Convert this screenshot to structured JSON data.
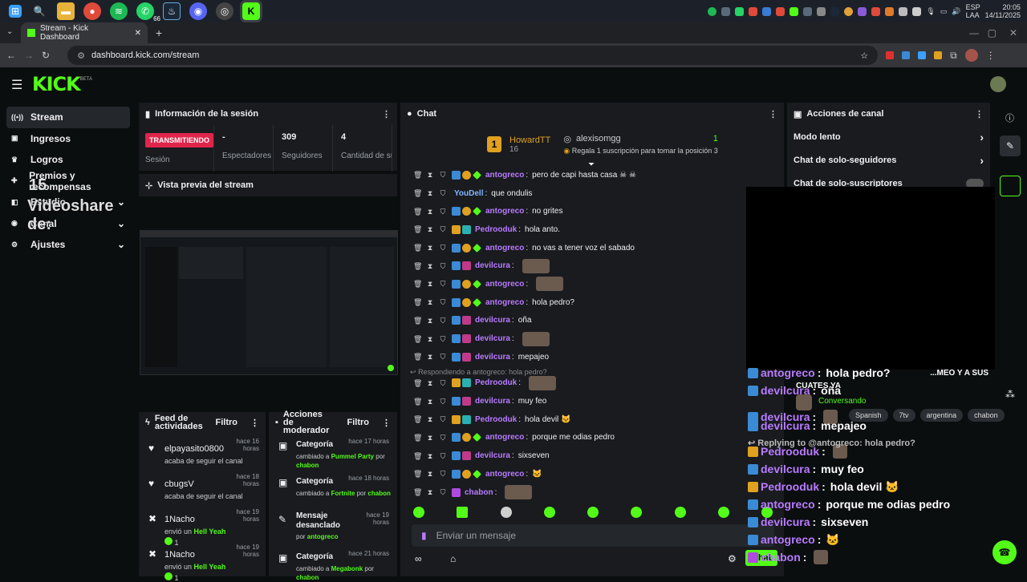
{
  "taskbar": {
    "time": "20:05",
    "date": "14/11/2025",
    "lang": "ESP",
    "lang2": "LAA",
    "badge_count": "66"
  },
  "browser": {
    "tab_title": "Stream - Kick Dashboard",
    "url": "dashboard.kick.com/stream"
  },
  "app": {
    "logo": "KICK",
    "logo_sup": "BETA"
  },
  "sidebar": {
    "items": [
      {
        "label": "Stream",
        "icon": "broadcast-icon"
      },
      {
        "label": "Ingresos",
        "icon": "money-icon"
      },
      {
        "label": "Logros",
        "icon": "trophy-icon"
      },
      {
        "label": "Premios y recompensas",
        "icon": "gift-icon"
      },
      {
        "label": "Estudio",
        "icon": "studio-icon"
      },
      {
        "label": "Canal",
        "icon": "user-icon"
      },
      {
        "label": "Ajustes",
        "icon": "gear-icon"
      }
    ],
    "overlay_text": "Videoshare de:",
    "overlay_num": "15"
  },
  "session": {
    "title": "Información de la sesión",
    "status": "TRANSMITIENDO",
    "status_label": "Sesión",
    "stats": [
      {
        "value": "-",
        "label": "Espectadores"
      },
      {
        "value": "309",
        "label": "Seguidores"
      },
      {
        "value": "4",
        "label": "Cantidad de suscripciones"
      }
    ]
  },
  "preview": {
    "title": "Vista previa del stream"
  },
  "feed": {
    "title": "Feed de actividades",
    "filter": "Filtro",
    "items": [
      {
        "user": "elpayasito0800",
        "time": "hace 16 horas",
        "desc": "acaba de seguir el canal"
      },
      {
        "user": "cbugsV",
        "time": "hace 18 horas",
        "desc": "acaba de seguir el canal"
      },
      {
        "user": "1Nacho",
        "time": "hace 19 horas",
        "desc": "envió un",
        "item": "Hell Yeah",
        "count": "1"
      },
      {
        "user": "1Nacho",
        "time": "hace 19 horas",
        "desc": "envió un",
        "item": "Hell Yeah",
        "count": "1"
      }
    ]
  },
  "modactions": {
    "title": "Acciones de moderador",
    "filter": "Filtro",
    "items": [
      {
        "title": "Categoría",
        "time": "hace 17 horas",
        "desc": "cambiado a",
        "value": "Pummel Party",
        "by_word": "por",
        "by": "chabon"
      },
      {
        "title": "Categoría",
        "time": "hace 18 horas",
        "desc": "cambiado a",
        "value": "Fortnite",
        "by_word": "por",
        "by": "chabon"
      },
      {
        "title": "Mensaje desanclado",
        "time": "hace 19 horas",
        "by_word": "por",
        "by": "antogreco"
      },
      {
        "title": "Categoría",
        "time": "hace 21 horas",
        "desc": "cambiado a",
        "value": "Megabonk",
        "by_word": "por",
        "by": "chabon"
      }
    ]
  },
  "chat": {
    "title": "Chat",
    "leader": {
      "rank": "1",
      "name": "HowardTT",
      "count": "16",
      "gifter": "alexisomgg",
      "gift_count": "1",
      "gift_text": "Regala 1 suscripción para tomar la posición 3"
    },
    "reply_note": "Respondiendo a antogreco: hola pedro?",
    "messages": [
      {
        "user": "antogreco",
        "color": "#b97bff",
        "text": "pero de capi hasta casa ☠ ☠"
      },
      {
        "user": "YouDell",
        "color": "#7fb7ff",
        "text": "que ondulis"
      },
      {
        "user": "antogreco",
        "color": "#b97bff",
        "text": "no grites"
      },
      {
        "user": "Pedrooduk",
        "color": "#b97bff",
        "text": "hola anto."
      },
      {
        "user": "antogreco",
        "color": "#b97bff",
        "text": "no vas a tener voz el sabado"
      },
      {
        "user": "devilcura",
        "color": "#b97bff",
        "text": ""
      },
      {
        "user": "antogreco",
        "color": "#b97bff",
        "text": ""
      },
      {
        "user": "antogreco",
        "color": "#b97bff",
        "text": "hola pedro?"
      },
      {
        "user": "devilcura",
        "color": "#b97bff",
        "text": "oña"
      },
      {
        "user": "devilcura",
        "color": "#b97bff",
        "text": ""
      },
      {
        "user": "devilcura",
        "color": "#b97bff",
        "text": "mepajeo"
      },
      {
        "user": "Pedrooduk",
        "color": "#b97bff",
        "text": ""
      },
      {
        "user": "devilcura",
        "color": "#b97bff",
        "text": "muy feo"
      },
      {
        "user": "Pedrooduk",
        "color": "#b97bff",
        "text": "hola devil 🐱"
      },
      {
        "user": "antogreco",
        "color": "#b97bff",
        "text": "porque me odias pedro"
      },
      {
        "user": "devilcura",
        "color": "#b97bff",
        "text": "sixseven"
      },
      {
        "user": "antogreco",
        "color": "#b97bff",
        "text": "🐱"
      },
      {
        "user": "chabon",
        "color": "#b97bff",
        "text": ""
      }
    ],
    "input_placeholder": "Enviar un mensaje",
    "send_label": "Chat"
  },
  "actions": {
    "title": "Acciones de canal",
    "items": [
      "Modo lento",
      "Chat de solo-seguidores",
      "Chat de solo-suscriptores"
    ]
  },
  "overlay": {
    "status": "Conversando",
    "title_line": "CUATES YA",
    "title_prefix": "...MEO Y A SUS",
    "tags": [
      "Spanish",
      "7tv",
      "argentina",
      "chabon"
    ],
    "reply_note": "Replying to @antogreco: hola pedro?",
    "messages": [
      {
        "user": "antogreco",
        "text": "hola pedro?"
      },
      {
        "user": "devilcura",
        "text": "oña"
      },
      {
        "user": "devilcura",
        "text": ""
      },
      {
        "user": "devilcura",
        "text": "mepajeo"
      },
      {
        "user": "Pedrooduk",
        "text": ""
      },
      {
        "user": "devilcura",
        "text": "muy feo"
      },
      {
        "user": "Pedrooduk",
        "text": "hola devil 🐱"
      },
      {
        "user": "antogreco",
        "text": "porque me odias pedro"
      },
      {
        "user": "devilcura",
        "text": "sixseven"
      },
      {
        "user": "antogreco",
        "text": "🐱"
      },
      {
        "user": "chabon",
        "text": ""
      }
    ]
  }
}
